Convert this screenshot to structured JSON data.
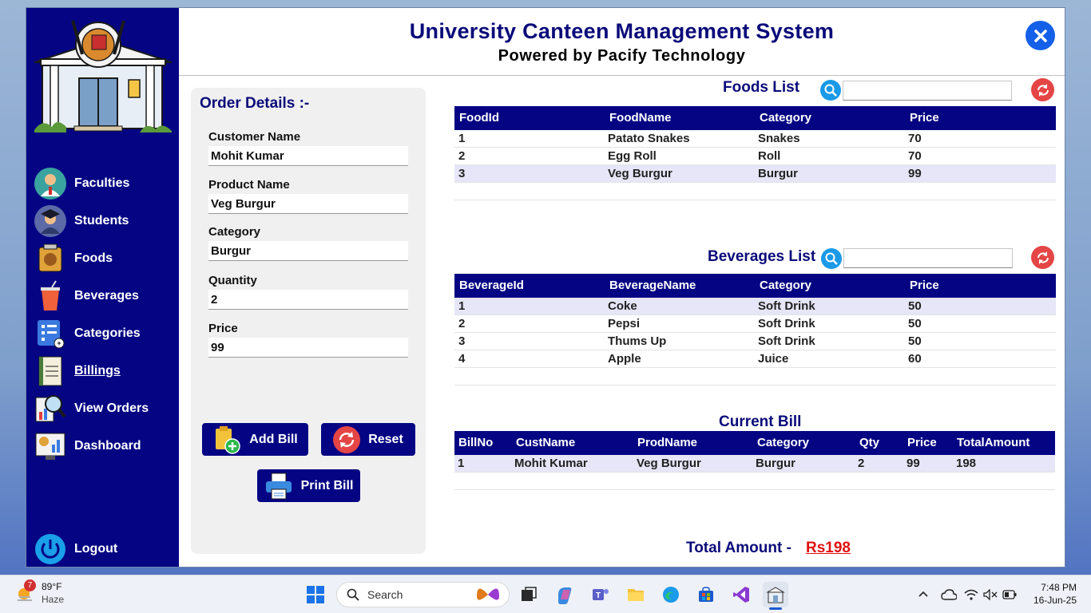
{
  "header": {
    "title": "University Canteen Management System",
    "subtitle": "Powered by Pacify Technology"
  },
  "sidebar": {
    "items": [
      {
        "label": "Faculties",
        "icon": "faculty-icon"
      },
      {
        "label": "Students",
        "icon": "student-icon"
      },
      {
        "label": "Foods",
        "icon": "food-icon"
      },
      {
        "label": "Beverages",
        "icon": "beverage-icon"
      },
      {
        "label": "Categories",
        "icon": "categories-icon"
      },
      {
        "label": "Billings",
        "icon": "bill-icon",
        "active": true
      },
      {
        "label": "View Orders",
        "icon": "view-orders-icon"
      },
      {
        "label": "Dashboard",
        "icon": "dashboard-icon"
      }
    ],
    "logout": "Logout"
  },
  "order": {
    "title": "Order Details :-",
    "customer_label": "Customer Name",
    "customer_value": "Mohit Kumar",
    "product_label": "Product Name",
    "product_value": "Veg Burgur",
    "category_label": "Category",
    "category_value": "Burgur",
    "quantity_label": "Quantity",
    "quantity_value": "2",
    "price_label": "Price",
    "price_value": "99",
    "add_bill": "Add Bill",
    "reset": "Reset",
    "print_bill": "Print Bill"
  },
  "foods": {
    "title": "Foods List",
    "search_value": "",
    "columns": [
      "FoodId",
      "FoodName",
      "Category",
      "Price"
    ],
    "rows": [
      [
        "1",
        "Patato Snakes",
        "Snakes",
        "70"
      ],
      [
        "2",
        "Egg Roll",
        "Roll",
        "70"
      ],
      [
        "3",
        "Veg Burgur",
        "Burgur",
        "99"
      ]
    ]
  },
  "beverages": {
    "title": "Beverages List",
    "search_value": "",
    "columns": [
      "BeverageId",
      "BeverageName",
      "Category",
      "Price"
    ],
    "rows": [
      [
        "1",
        "Coke",
        "Soft Drink",
        "50"
      ],
      [
        "2",
        "Pepsi",
        "Soft Drink",
        "50"
      ],
      [
        "3",
        "Thums Up",
        "Soft Drink",
        "50"
      ],
      [
        "4",
        "Apple",
        "Juice",
        "60"
      ]
    ]
  },
  "bill": {
    "title": "Current Bill",
    "columns": [
      "BillNo",
      "CustName",
      "ProdName",
      "Category",
      "Qty",
      "Price",
      "TotalAmount"
    ],
    "rows": [
      [
        "1",
        "Mohit Kumar",
        "Veg Burgur",
        "Burgur",
        "2",
        "99",
        "198"
      ]
    ]
  },
  "total": {
    "label": "Total Amount -",
    "value": "Rs198"
  },
  "taskbar": {
    "weather_badge": "7",
    "temperature": "89°F",
    "condition": "Haze",
    "search_placeholder": "Search",
    "time": "7:48 PM",
    "date": "16-Jun-25"
  },
  "colors": {
    "sidebar": "#050584",
    "title": "#0a0a7a",
    "total_value": "#e01010"
  }
}
